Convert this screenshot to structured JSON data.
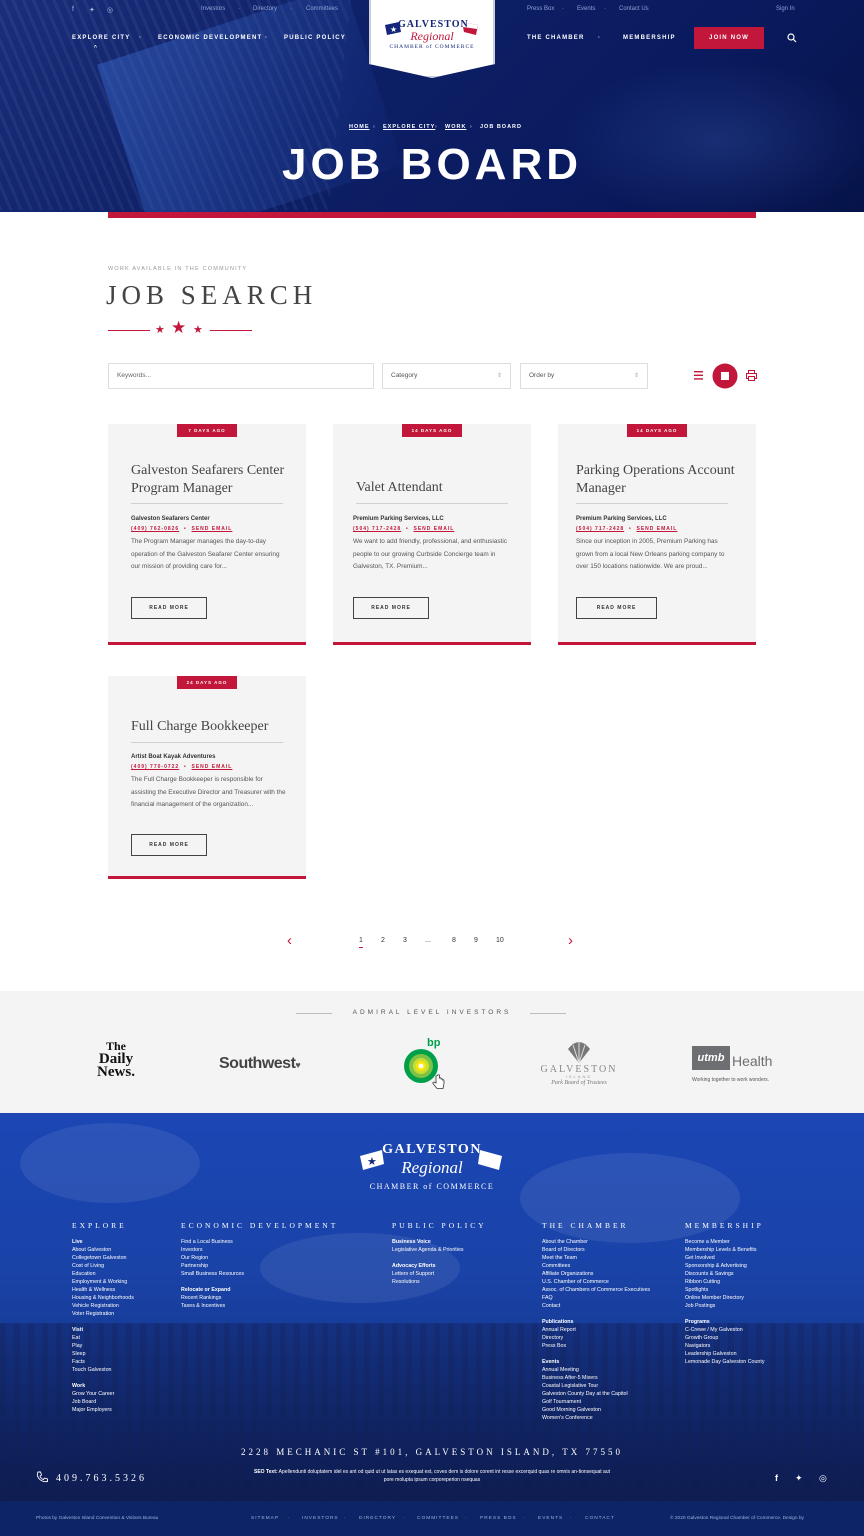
{
  "topbar": {
    "left_links": [
      "Investors",
      "Directory",
      "Committees"
    ],
    "right_links": [
      "Press Box",
      "Events",
      "Contact Us"
    ],
    "sign_in": "Sign In"
  },
  "nav": {
    "left": [
      "EXPLORE CITY",
      "ECONOMIC DEVELOPMENT",
      "PUBLIC POLICY"
    ],
    "right": [
      "THE CHAMBER",
      "MEMBERSHIP"
    ],
    "join": "JOIN NOW"
  },
  "logo": {
    "line1": "GALVESTON",
    "line2": "Regional",
    "line3": "CHAMBER of COMMERCE"
  },
  "breadcrumb": [
    "HOME",
    "EXPLORE CITY",
    "WORK",
    "JOB BOARD"
  ],
  "page_title": "JOB BOARD",
  "section": {
    "eyebrow": "WORK AVAILABLE IN THE COMMUNITY",
    "title": "JOB SEARCH"
  },
  "filters": {
    "keywords_placeholder": "Keywords...",
    "category": "Category",
    "order": "Order by"
  },
  "jobs": [
    {
      "age": "7 DAYS AGO",
      "title": "Galveston Seafarers Center Program Manager",
      "company": "Galveston Seafarers Center",
      "phone": "(409) 762-0826",
      "email": "SEND EMAIL",
      "desc": "The Program Manager manages the day-to-day operation of the Galveston Seafarer Center ensuring our mission of providing care for...",
      "button": "READ MORE"
    },
    {
      "age": "14 DAYS AGO",
      "title": "Valet Attendant",
      "company": "Premium Parking Services, LLC",
      "phone": "(504) 717-2428",
      "email": "SEND EMAIL",
      "desc": "We want to add friendly, professional, and enthusiastic people to our growing Curbside Concierge team in Galveston, TX. Premium...",
      "button": "READ MORE"
    },
    {
      "age": "14 DAYS AGO",
      "title": "Parking Operations Account Manager",
      "company": "Premium Parking Services, LLC",
      "phone": "(504) 717-2428",
      "email": "SEND EMAIL",
      "desc": "Since our inception in 2005, Premium Parking has grown from a local New Orleans parking company to over 150 locations nationwide. We are proud...",
      "button": "READ MORE"
    },
    {
      "age": "24 DAYS AGO",
      "title": "Full Charge Bookkeeper",
      "company": "Artist Boat Kayak Adventures",
      "phone": "(409) 770-0722",
      "email": "SEND EMAIL",
      "desc": "The Full Charge Bookkeeper is responsible for assisting the Executive Director and Treasurer with the financial management of the organization...",
      "button": "READ MORE"
    }
  ],
  "pagination": {
    "pages": [
      "1",
      "2",
      "3",
      "...",
      "8",
      "9",
      "10"
    ],
    "current": "1"
  },
  "investors": {
    "title": "ADMIRAL LEVEL INVESTORS",
    "daily_news": [
      "The",
      "Daily",
      "News."
    ],
    "southwest": "Southwest",
    "bp": "bp",
    "galveston_parks": {
      "name": "GALVESTON",
      "sub": "ISLAND",
      "tag": "Park Board of Trustees"
    },
    "utmb": {
      "mark": "utmb",
      "word": "Health",
      "tagline": "Working together to work wonders."
    }
  },
  "footer": {
    "columns": [
      {
        "heading": "EXPLORE",
        "groups": [
          {
            "title": "Live",
            "items": [
              "About Galveston",
              "Collegetown Galveston",
              "Cost of Living",
              "Education",
              "Employment & Working",
              "Health & Wellness",
              "Housing & Neighborhoods",
              "Vehicle Registration",
              "Voter Registration"
            ]
          },
          {
            "title": "Visit",
            "items": [
              "Eat",
              "Play",
              "Sleep",
              "Facts",
              "Touch Galveston"
            ]
          },
          {
            "title": "Work",
            "items": [
              "Grow Your Career",
              "Job Board",
              "Major Employers"
            ]
          }
        ]
      },
      {
        "heading": "ECONOMIC DEVELOPMENT",
        "groups": [
          {
            "title": "",
            "items": [
              "Find a Local Business",
              "Investors",
              "Our Region",
              "Partnership",
              "Small Business Resources"
            ]
          },
          {
            "title": "Relocate or Expand",
            "items": [
              "Recent Rankings",
              "Taxes & Incentives"
            ]
          }
        ]
      },
      {
        "heading": "PUBLIC POLICY",
        "groups": [
          {
            "title": "Business Voice",
            "items": [
              "Legislative Agenda & Priorities"
            ]
          },
          {
            "title": "Advocacy Efforts",
            "items": [
              "Letters of Support",
              "Resolutions"
            ]
          }
        ]
      },
      {
        "heading": "THE CHAMBER",
        "groups": [
          {
            "title": "",
            "items": [
              "About the Chamber",
              "Board of Directors",
              "Meet the Team",
              "Committees",
              "Affiliate Organizations",
              "U.S. Chamber of Commerce",
              "Assoc. of Chambers of Commerce Executives",
              "FAQ",
              "Contact"
            ]
          },
          {
            "title": "Publications",
            "items": [
              "Annual Report",
              "Directory",
              "Press Box"
            ]
          },
          {
            "title": "Events",
            "items": [
              "Annual Meeting",
              "Business After-5 Mixers",
              "Coastal Legislative Tour",
              "Galveston County Day at the Capitol",
              "Golf Tournament",
              "Good Morning Galveston",
              "Women's Conference"
            ]
          }
        ]
      },
      {
        "heading": "MEMBERSHIP",
        "groups": [
          {
            "title": "",
            "items": [
              "Become a Member",
              "Membership Levels & Benefits",
              "Get Involved",
              "Sponsorship & Advertising",
              "Discounts & Savings",
              "Ribbon Cutting",
              "Spotlights",
              "Online Member Directory",
              "Job Postings"
            ]
          },
          {
            "title": "Programs",
            "items": [
              "C-Crewe / My Galveston",
              "Growth Group",
              "Navigators",
              "Leadership Galveston",
              "Lemonade Day Galveston County"
            ]
          }
        ]
      }
    ],
    "address": "2228 MECHANIC ST #101, GALVESTON ISLAND, TX 77550",
    "phone": "409.763.5326",
    "seo_label": "SEO Text:",
    "seo_text": "Apellendunti doluptatem idel es ant od quid ut ut latas es exequat est, coves dem is dolore corent int resse excerquid quas re omnis an-tionsequat aut pore molupta ipsum corporeperion nsequas",
    "photos_credit": "Photos by Galveston Island Convention & Visitors Bureau",
    "bottom_links": [
      "SITEMAP",
      "INVESTORS",
      "DIRECTORY",
      "COMMITTEES",
      "PRESS BOX",
      "EVENTS",
      "CONTACT"
    ],
    "copyright": "© 2020 Galveston Regional Chamber of Commerce. Design by"
  },
  "colors": {
    "navy": "#0d1f66",
    "red": "#c2163a",
    "footer_blue": "#1b46b4"
  }
}
